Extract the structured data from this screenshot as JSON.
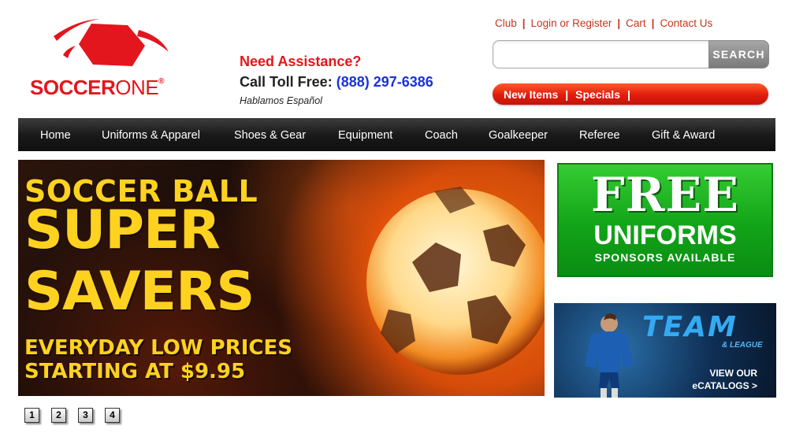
{
  "brand": {
    "name_part1": "SOCCER",
    "name_part2": "ONE",
    "reg_mark": "®",
    "color": "#e3161d"
  },
  "assistance": {
    "question": "Need Assistance?",
    "toll_label": "Call Toll Free:",
    "phone": "(888) 297-6386",
    "spanish": "Hablamos Español"
  },
  "top_links": [
    "Club",
    "Login or Register",
    "Cart",
    "Contact Us"
  ],
  "top_link_separator": "|",
  "search": {
    "value": "",
    "placeholder": "",
    "button_label": "SEARCH"
  },
  "promo_bar": {
    "items": [
      "New Items",
      "Specials"
    ],
    "separator": "|"
  },
  "main_nav": [
    "Home",
    "Uniforms & Apparel",
    "Shoes & Gear",
    "Equipment",
    "Coach",
    "Goalkeeper",
    "Referee",
    "Gift & Award"
  ],
  "hero": {
    "line1": "SOCCER BALL",
    "line2": "SUPER",
    "line3": "SAVERS",
    "line4": "EVERYDAY LOW PRICES",
    "line5": "STARTING AT $9.95",
    "text_color": "#ffd21f"
  },
  "free_uniforms": {
    "big": "FREE",
    "mid": "UNIFORMS",
    "small": "SPONSORS AVAILABLE"
  },
  "team_catalog": {
    "title": "TEAM",
    "subtitle": "& LEAGUE",
    "cta_line1": "VIEW OUR",
    "cta_line2": "eCATALOGS >"
  },
  "pager": [
    "1",
    "2",
    "3",
    "4"
  ]
}
